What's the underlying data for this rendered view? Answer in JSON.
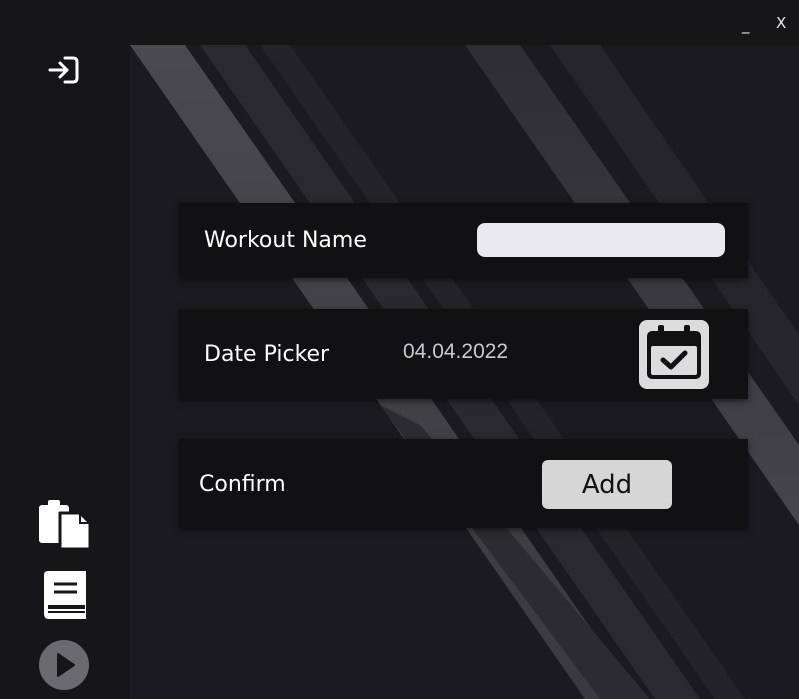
{
  "window_controls": {
    "minimize_label": "_",
    "close_label": "X"
  },
  "sidebar": {
    "items": [
      {
        "icon": "login-icon"
      },
      {
        "icon": "copy-files-icon"
      },
      {
        "icon": "book-icon"
      },
      {
        "icon": "play-icon"
      }
    ]
  },
  "form": {
    "workout_name": {
      "label": "Workout Name",
      "value": "",
      "placeholder": ""
    },
    "date_picker": {
      "label": "Date Picker",
      "value": "04.04.2022",
      "icon": "calendar-check-icon"
    },
    "confirm": {
      "label": "Confirm",
      "button_label": "Add"
    }
  },
  "colors": {
    "background": "#161619",
    "card": "#111113",
    "input": "#e9e9ee",
    "button": "#d6d6d6",
    "text": "#ffffff"
  }
}
